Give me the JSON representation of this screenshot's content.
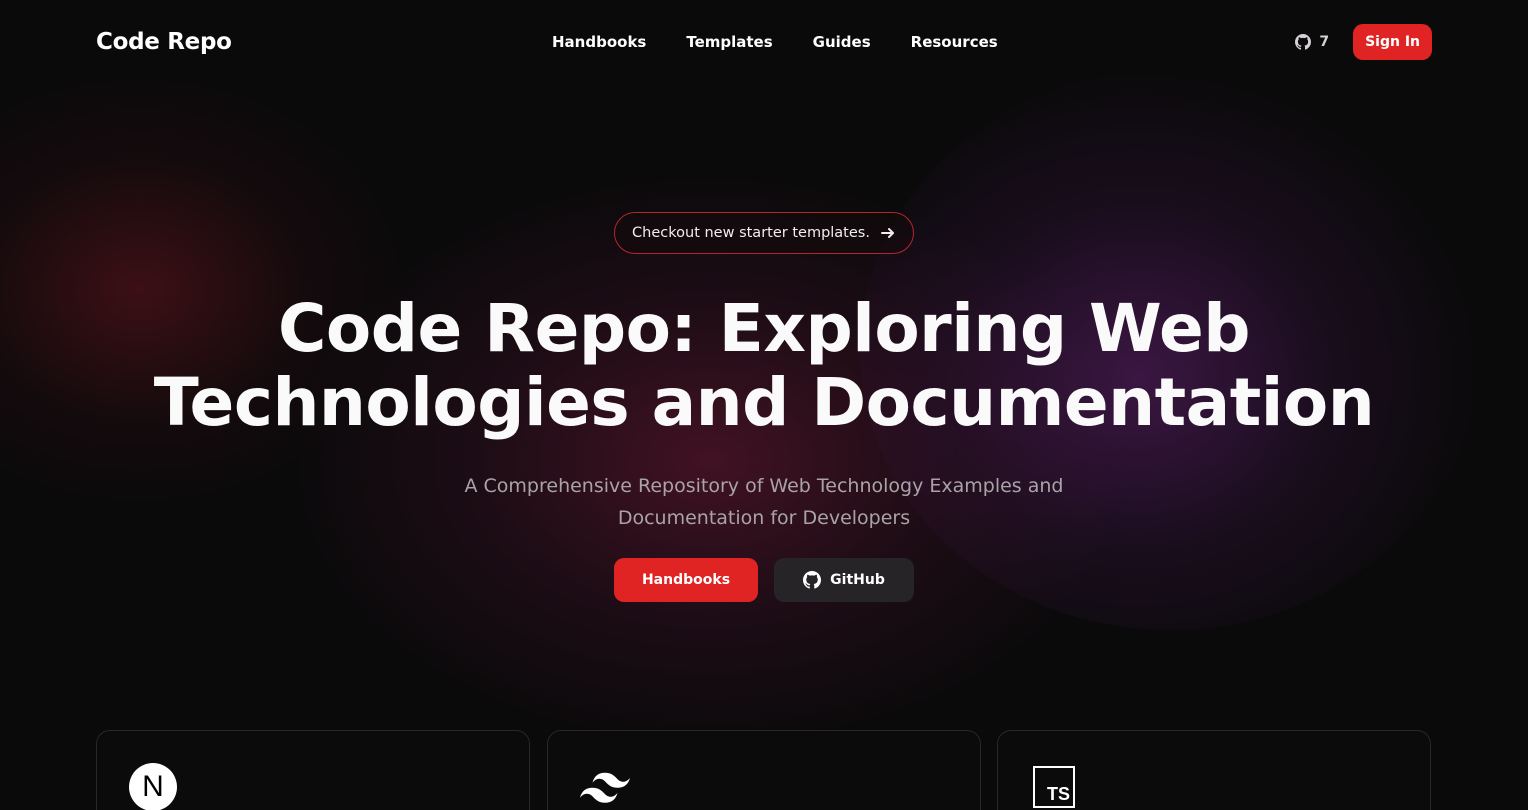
{
  "header": {
    "logo": "Code Repo",
    "nav": [
      "Handbooks",
      "Templates",
      "Guides",
      "Resources"
    ],
    "github_count": "7",
    "signin_label": "Sign In"
  },
  "hero": {
    "announcement": "Checkout new starter templates.",
    "title_line1": "Code Repo: Exploring Web",
    "title_line2": "Technologies and Documentation",
    "subtitle_line1": "A Comprehensive Repository of Web Technology Examples and",
    "subtitle_line2": "Documentation for Developers",
    "primary_button": "Handbooks",
    "secondary_button": "GitHub"
  },
  "cards": [
    {
      "icon": "nextjs-icon",
      "icon_text": "N"
    },
    {
      "icon": "tailwind-icon"
    },
    {
      "icon": "typescript-icon",
      "icon_text": "TS"
    }
  ],
  "colors": {
    "accent": "#e02424",
    "background": "#0b0a0b",
    "secondary_button": "#262426"
  }
}
